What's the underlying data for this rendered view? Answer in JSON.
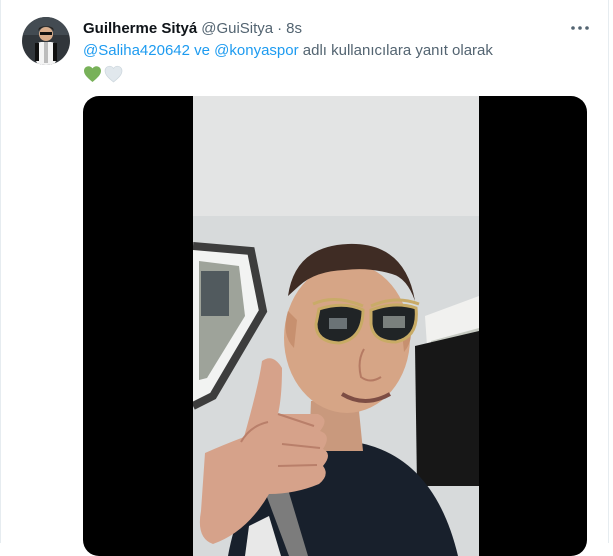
{
  "tweet": {
    "author": {
      "display_name": "Guilherme Sityá",
      "handle": "@GuiSitya",
      "separator": "·",
      "time": "8s"
    },
    "reply": {
      "mention_1": "@Saliha420642",
      "connector": " ve ",
      "mention_2": "@konyaspor",
      "suffix": " adlı kullanıcılara yanıt olarak"
    },
    "emojis": [
      "green-heart-icon",
      "white-heart-icon"
    ]
  },
  "colors": {
    "link": "#1d9bf0",
    "secondary_text": "#536471",
    "primary_text": "#0f1419",
    "green_heart": "#78b159",
    "white_heart": "#e1e8ed"
  }
}
